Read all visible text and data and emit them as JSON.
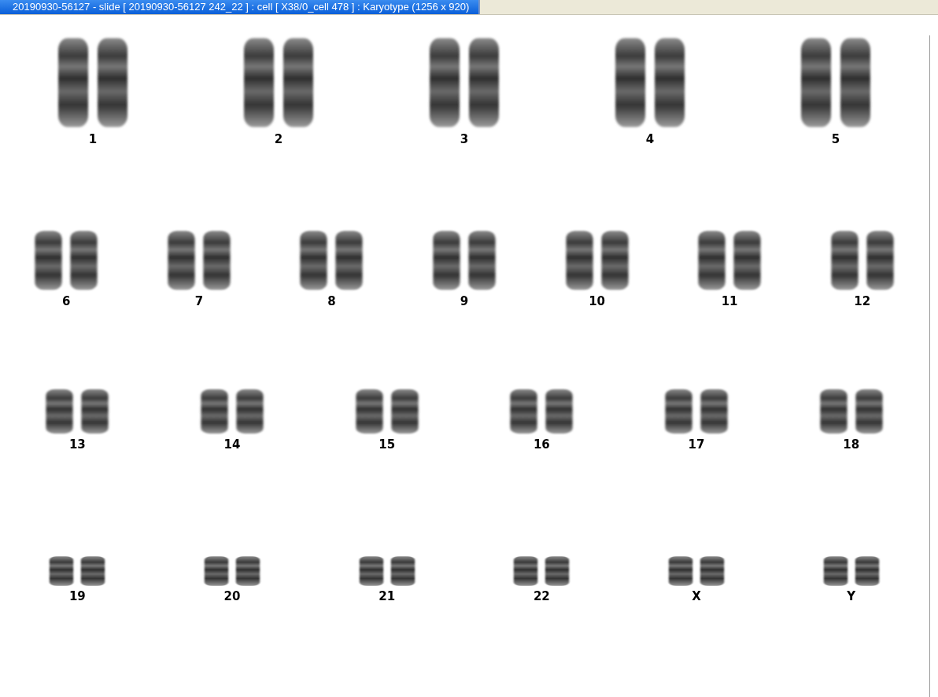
{
  "window": {
    "title": "20190930-56127 - slide [ 20190930-56127 242_22 ] : cell [ X38/0_cell 478 ] : Karyotype  (1256 x 920)"
  },
  "karyotype": {
    "rows": [
      {
        "pairs": [
          {
            "label": "1"
          },
          {
            "label": "2"
          },
          {
            "label": "3"
          },
          {
            "label": "4"
          },
          {
            "label": "5"
          }
        ]
      },
      {
        "pairs": [
          {
            "label": "6"
          },
          {
            "label": "7"
          },
          {
            "label": "8"
          },
          {
            "label": "9"
          },
          {
            "label": "10"
          },
          {
            "label": "11"
          },
          {
            "label": "12"
          }
        ]
      },
      {
        "pairs": [
          {
            "label": "13"
          },
          {
            "label": "14"
          },
          {
            "label": "15"
          },
          {
            "label": "16"
          },
          {
            "label": "17"
          },
          {
            "label": "18"
          }
        ]
      },
      {
        "pairs": [
          {
            "label": "19"
          },
          {
            "label": "20"
          },
          {
            "label": "21"
          },
          {
            "label": "22"
          },
          {
            "label": "X"
          },
          {
            "label": "Y"
          }
        ]
      }
    ]
  }
}
